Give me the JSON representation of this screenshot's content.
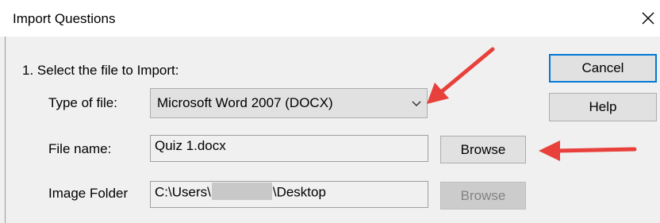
{
  "window": {
    "title": "Import Questions",
    "close_glyph": "✕"
  },
  "section": {
    "title": "1.  Select the file to Import:"
  },
  "fields": {
    "type_label": "Type of file:",
    "type_value": "Microsoft Word 2007 (DOCX)",
    "file_label": "File name:",
    "file_value": "Quiz 1.docx",
    "image_label": "Image Folder",
    "image_value_prefix": "C:\\Users\\",
    "image_value_suffix": "\\Desktop"
  },
  "buttons": {
    "cancel": "Cancel",
    "help": "Help",
    "browse": "Browse",
    "browse_image": "Browse"
  },
  "icons": {
    "close": "close-icon",
    "dropdown": "chevron-down-icon",
    "annotation": "red-arrow"
  },
  "colors": {
    "annotation_arrow": "#e8403a",
    "focus_border": "#0078d7",
    "dialog_bg": "#f0f0f0",
    "disabled_text": "#838383"
  }
}
